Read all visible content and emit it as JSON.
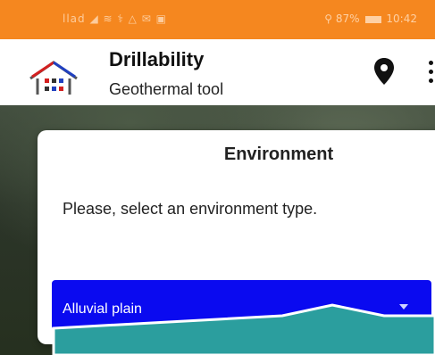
{
  "status_bar": {
    "left_icons": "llad ◢ ≋ ⚕ △ ✉ ▣",
    "battery": "87%",
    "time": "10:42"
  },
  "app_bar": {
    "title": "Drillability",
    "subtitle": "Geothermal tool",
    "icons": [
      "app-logo-house-icon",
      "location-pin-icon",
      "more-vertical-icon"
    ]
  },
  "dialog": {
    "title": "Environment",
    "message": "Please, select an environment type.",
    "select": {
      "value": "Alluvial plain"
    }
  },
  "colors": {
    "status_bar": "#f5871f",
    "select_background": "#0a0af0",
    "overlay": "#2b9e9e"
  }
}
